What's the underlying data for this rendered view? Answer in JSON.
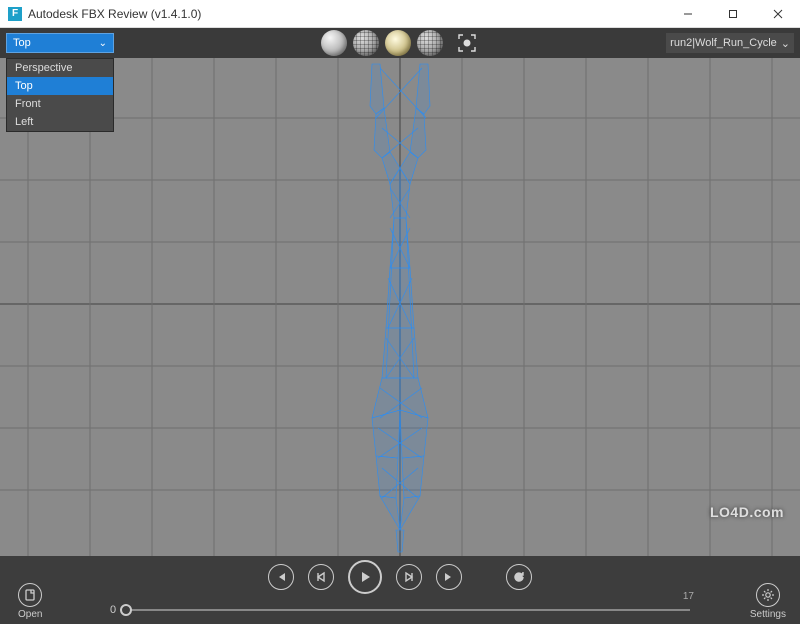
{
  "window": {
    "title": "Autodesk FBX Review (v1.4.1.0)",
    "app_icon_letter": "F"
  },
  "toolbar": {
    "view_selected": "Top",
    "view_options": [
      "Perspective",
      "Top",
      "Front",
      "Left"
    ],
    "shading_modes": [
      "smooth-shaded",
      "wireframe-shaded",
      "lit",
      "textured"
    ],
    "frame_selected_label": "frame-selection",
    "animation_selected": "run2|Wolf_Run_Cycle"
  },
  "playback": {
    "first_frame": "first-frame",
    "prev_frame": "prev-frame",
    "play": "play",
    "next_frame": "next-frame",
    "last_frame": "last-frame",
    "loop": "loop"
  },
  "timeline": {
    "current_frame": "0",
    "end_frame": "17"
  },
  "bottom": {
    "open_label": "Open",
    "settings_label": "Settings"
  },
  "watermark": "LO4D.com",
  "colors": {
    "accent": "#1f7fd6",
    "wireframe": "#2a8ef5",
    "panel": "#3d3d3d",
    "viewport": "#8a8a8a"
  }
}
